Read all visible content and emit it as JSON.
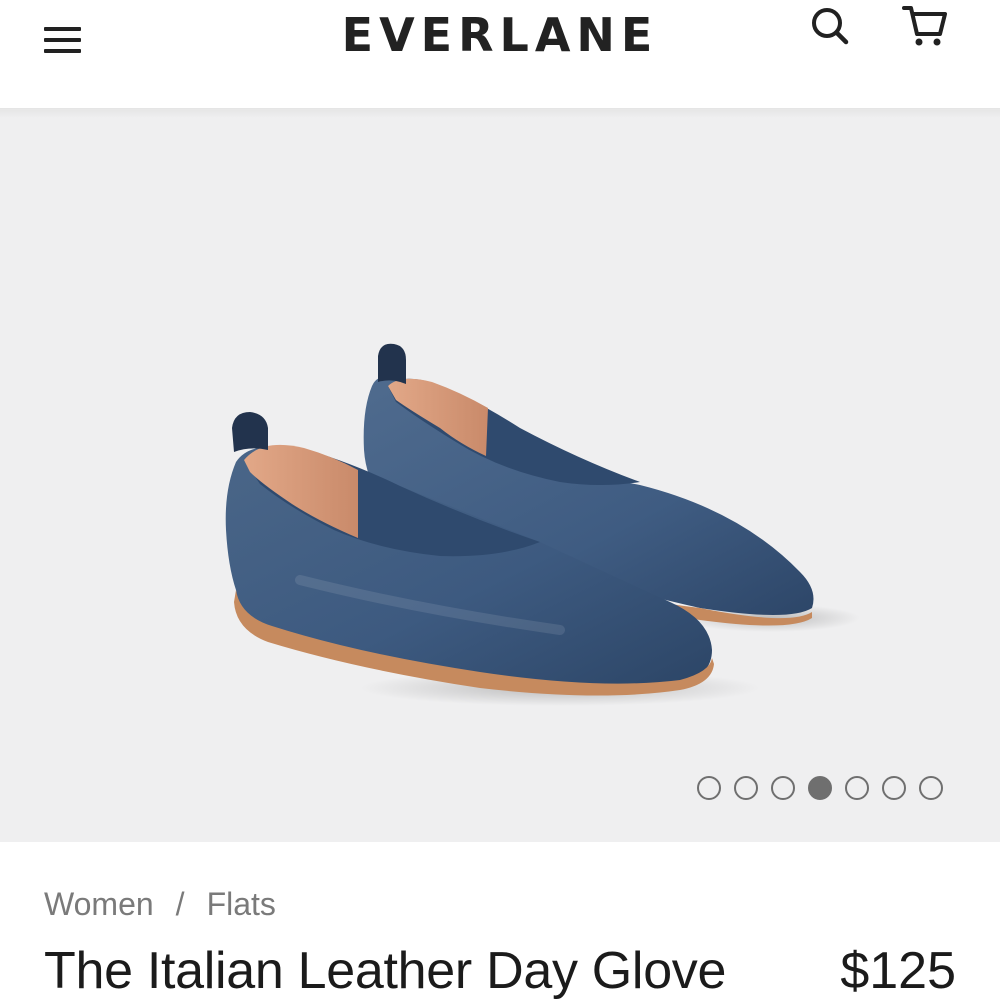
{
  "header": {
    "logo": "EVERLANE",
    "menu_icon": "hamburger-menu-icon",
    "search_icon": "search-icon",
    "cart_icon": "shopping-cart-icon"
  },
  "hero": {
    "image": "blue-leather-flats-photo",
    "carousel": {
      "total": 7,
      "active_index": 3
    }
  },
  "breadcrumb": {
    "items": [
      "Women",
      "Flats"
    ],
    "separator": "/"
  },
  "product": {
    "title": "The Italian Leather Day Glove",
    "price": "$125"
  },
  "colors": {
    "logo": "#222222",
    "shoe": "#3d5a80",
    "hero_background": "#efeff0",
    "breadcrumb_text": "#7a7a7a",
    "title_text": "#1b1b1b"
  }
}
